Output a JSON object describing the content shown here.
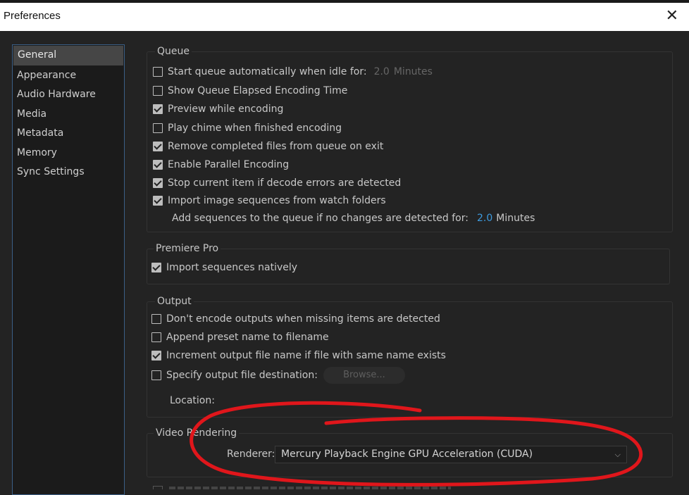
{
  "window": {
    "title": "Preferences",
    "close_glyph": "✕"
  },
  "sidebar": {
    "items": [
      {
        "label": "General",
        "active": true
      },
      {
        "label": "Appearance"
      },
      {
        "label": "Audio Hardware"
      },
      {
        "label": "Media"
      },
      {
        "label": "Metadata"
      },
      {
        "label": "Memory"
      },
      {
        "label": "Sync Settings"
      }
    ]
  },
  "queue": {
    "label": "Queue",
    "start_auto": {
      "label": "Start queue automatically when idle for:",
      "value": "2.0",
      "unit": "Minutes",
      "checked": false
    },
    "show_elapsed": {
      "label": "Show Queue Elapsed Encoding Time",
      "checked": false
    },
    "preview": {
      "label": "Preview while encoding",
      "checked": true
    },
    "chime": {
      "label": "Play chime when finished encoding",
      "checked": false
    },
    "remove_completed": {
      "label": "Remove completed files from queue on exit",
      "checked": true
    },
    "parallel": {
      "label": "Enable Parallel Encoding",
      "checked": true
    },
    "stop_decode": {
      "label": "Stop current item if decode errors are detected",
      "checked": true
    },
    "import_images": {
      "label": "Import image sequences from watch folders",
      "checked": true
    },
    "add_sequences": {
      "label": "Add sequences to the queue if no changes are detected for:",
      "value": "2.0",
      "unit": "Minutes"
    }
  },
  "premiere": {
    "label": "Premiere Pro",
    "import_native": {
      "label": "Import sequences natively",
      "checked": true
    }
  },
  "output": {
    "label": "Output",
    "dont_encode": {
      "label": "Don't encode outputs when missing items are detected",
      "checked": false
    },
    "append_preset": {
      "label": "Append preset name to filename",
      "checked": false
    },
    "increment": {
      "label": "Increment output file name if file with same name exists",
      "checked": true
    },
    "specify_dest": {
      "label": "Specify output file destination:",
      "checked": false
    },
    "browse_label": "Browse...",
    "location_label": "Location:"
  },
  "video_rendering": {
    "label": "Video Rendering",
    "renderer_label": "Renderer:",
    "renderer_value": "Mercury Playback Engine GPU Acceleration (CUDA)"
  },
  "colors": {
    "annotation": "#e0161b",
    "accent": "#3d9bdf",
    "sidebar_border": "#3b5f86"
  }
}
